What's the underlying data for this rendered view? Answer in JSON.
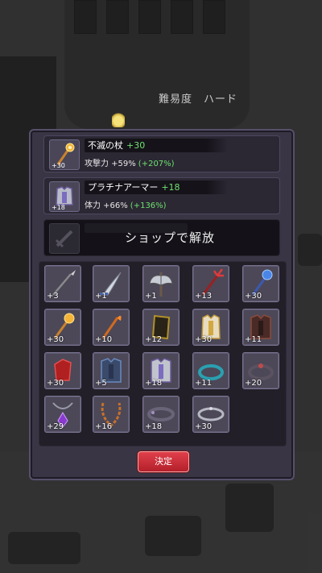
{
  "scene": {
    "difficulty_label": "難易度",
    "difficulty_value": "ハード"
  },
  "equipped": [
    {
      "name": "不滅の杖",
      "plus": "+30",
      "thumb_level": "+30",
      "stat_label": "攻撃力 +59%",
      "stat_pct": "(+207%)",
      "icon": "golden-staff-icon"
    },
    {
      "name": "プラチナアーマー",
      "plus": "+18",
      "thumb_level": "+18",
      "stat_label": "体力 +66%",
      "stat_pct": "(+136%)",
      "icon": "platinum-armor-icon"
    }
  ],
  "locked_slot": {
    "label": "ショップで解放",
    "icon": "sword-silhouette-icon"
  },
  "inventory": [
    {
      "level": "+3",
      "icon": "spear-icon"
    },
    {
      "level": "+1",
      "icon": "scimitar-icon"
    },
    {
      "level": "+1",
      "icon": "battle-axe-icon"
    },
    {
      "level": "+13",
      "icon": "red-trident-icon"
    },
    {
      "level": "+30",
      "icon": "blue-mace-icon"
    },
    {
      "level": "+30",
      "icon": "golden-staff-icon"
    },
    {
      "level": "+10",
      "icon": "fire-staff-icon"
    },
    {
      "level": "+12",
      "icon": "shield-icon"
    },
    {
      "level": "+30",
      "icon": "gold-armor-icon"
    },
    {
      "level": "+11",
      "icon": "dark-armor-icon"
    },
    {
      "level": "+30",
      "icon": "red-gauntlet-icon"
    },
    {
      "level": "+5",
      "icon": "blue-armor-icon"
    },
    {
      "level": "+18",
      "icon": "platinum-armor-icon"
    },
    {
      "level": "+11",
      "icon": "teal-ring-icon"
    },
    {
      "level": "+20",
      "icon": "dark-ring-icon"
    },
    {
      "level": "+29",
      "icon": "purple-amulet-icon"
    },
    {
      "level": "+16",
      "icon": "chain-amulet-icon"
    },
    {
      "level": "+18",
      "icon": "dark-bracelet-icon"
    },
    {
      "level": "+30",
      "icon": "silver-bracelet-icon"
    }
  ],
  "confirm_label": "決定",
  "colors": {
    "panel": "#3a3544",
    "stat_bonus_green": "#6ee36e",
    "confirm_red": "#d0303a"
  }
}
